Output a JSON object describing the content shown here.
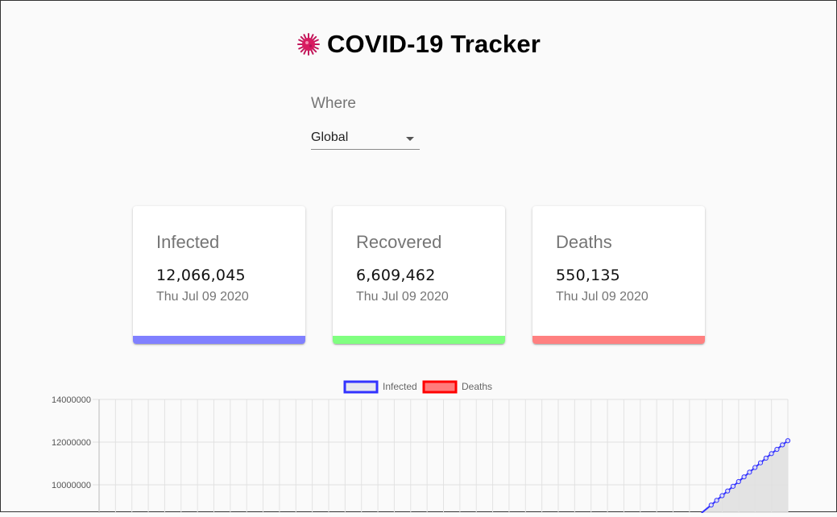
{
  "header": {
    "title": "COVID-19 Tracker",
    "icon": "virus-icon",
    "icon_color": "#c2185b"
  },
  "country_picker": {
    "label": "Where",
    "selected": "Global"
  },
  "cards": [
    {
      "title": "Infected",
      "value": "12,066,045",
      "date": "Thu Jul 09 2020",
      "color": "#8080ff"
    },
    {
      "title": "Recovered",
      "value": "6,609,462",
      "date": "Thu Jul 09 2020",
      "color": "#80ff80"
    },
    {
      "title": "Deaths",
      "value": "550,135",
      "date": "Thu Jul 09 2020",
      "color": "#ff8080"
    }
  ],
  "chart_data": {
    "type": "line",
    "legend": [
      {
        "name": "Infected",
        "border": "#3333ff",
        "fill": "#e6e6ee"
      },
      {
        "name": "Deaths",
        "border": "#ff0000",
        "fill": "#ff7b7b"
      }
    ],
    "legend_position": "top",
    "yticks": [
      "14000000",
      "12000000",
      "10000000"
    ],
    "ylim": [
      0,
      14000000
    ],
    "grid": true,
    "series": [
      {
        "name": "Infected",
        "color": "#3333ff",
        "fill": "#e0e0e0",
        "values": [
          9050000,
          9270000,
          9490000,
          9710000,
          9930000,
          10150000,
          10370000,
          10590000,
          10810000,
          11030000,
          11250000,
          11460000,
          11660000,
          11870000,
          12066045
        ]
      }
    ]
  }
}
